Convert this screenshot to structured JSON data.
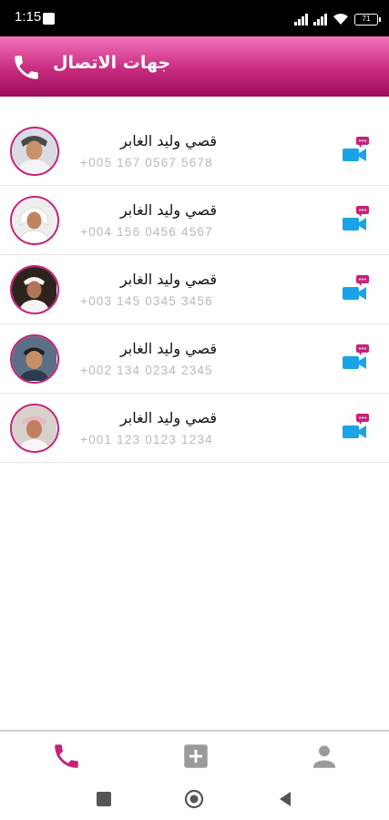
{
  "status_bar": {
    "time": "1:15",
    "battery": "71"
  },
  "header": {
    "title": "جهات الاتصال",
    "icon": "phone-icon"
  },
  "contacts": [
    {
      "name": "قصي وليد الغابر",
      "phone": "+005 167 0567 5678"
    },
    {
      "name": "قصي وليد الغابر",
      "phone": "+004 156 0456 4567"
    },
    {
      "name": "قصي وليد الغابر",
      "phone": "+003 145 0345 3456"
    },
    {
      "name": "قصي وليد الغابر",
      "phone": "+002 134 0234 2345"
    },
    {
      "name": "قصي وليد الغابر",
      "phone": "+001 123 0123 1234"
    }
  ],
  "bottom_nav": {
    "items": [
      {
        "id": "calls",
        "icon": "phone-icon",
        "active": true
      },
      {
        "id": "add",
        "icon": "add-box-icon",
        "active": false
      },
      {
        "id": "profile",
        "icon": "person-icon",
        "active": false
      }
    ]
  },
  "colors": {
    "accent": "#c8207a",
    "header_top": "#f374bb",
    "header_bottom": "#9e0d59",
    "video_blue": "#1aa3e8",
    "phone_text": "#b9b9b9",
    "nav_inactive": "#9a9a9a"
  }
}
